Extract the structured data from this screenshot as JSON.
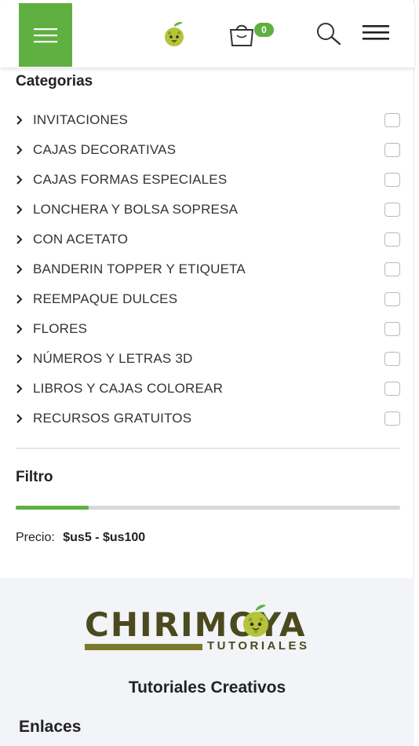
{
  "header": {
    "cart_count": "0"
  },
  "categories": {
    "title": "Categorias",
    "items": [
      {
        "label": "INVITACIONES"
      },
      {
        "label": "CAJAS DECORATIVAS"
      },
      {
        "label": "CAJAS FORMAS ESPECIALES"
      },
      {
        "label": "LONCHERA Y BOLSA SOPRESA"
      },
      {
        "label": "CON ACETATO"
      },
      {
        "label": "BANDERIN TOPPER Y ETIQUETA"
      },
      {
        "label": "REEMPAQUE DULCES"
      },
      {
        "label": "FLORES"
      },
      {
        "label": "NÚMEROS Y LETRAS 3D"
      },
      {
        "label": "LIBROS Y CAJAS COLOREAR"
      },
      {
        "label": "RECURSOS GRATUITOS"
      }
    ]
  },
  "filter": {
    "title": "Filtro",
    "price_label": "Precio:",
    "price_range": "$us5 - $us100",
    "slider_fill_fraction": 0.19
  },
  "footer": {
    "brand_word": "CHIRIMOYA",
    "brand_sub": "TUTORIALES",
    "tagline": "Tutoriales Creativos",
    "links_title": "Enlaces"
  },
  "colors": {
    "accent": "#5fb041",
    "brand_dark": "#4b4a1f"
  }
}
